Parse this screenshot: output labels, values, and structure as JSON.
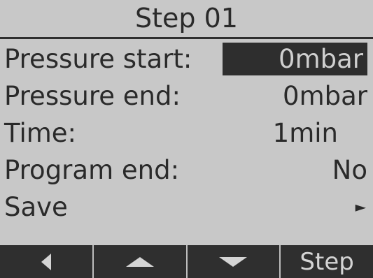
{
  "header": {
    "title": "Step 01"
  },
  "rows": [
    {
      "label": "Pressure start:",
      "value": "0mbar",
      "selected": true
    },
    {
      "label": "Pressure end:",
      "value": "0mbar"
    },
    {
      "label": "Time:",
      "value": "1min"
    },
    {
      "label": "Program end:",
      "value": "No"
    },
    {
      "label": "Save",
      "value": "►"
    }
  ],
  "softkeys": {
    "back_icon": "triangle-left-icon",
    "up_icon": "triangle-up-icon",
    "down_icon": "triangle-down-icon",
    "step_label": "Step"
  },
  "colors": {
    "background": "#c8c8c8",
    "selection": "#2e2e2e",
    "softkey_bar": "#2f2f2f"
  }
}
